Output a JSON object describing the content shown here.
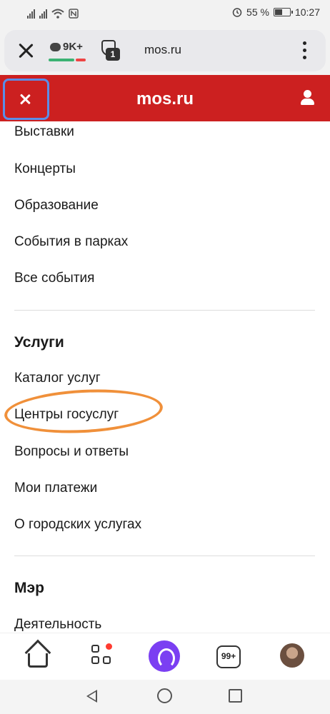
{
  "status_bar": {
    "battery_percent": "55 %",
    "battery_level": 0.55,
    "time": "10:27",
    "icons": [
      "signal-icon",
      "wifi-icon",
      "nfc-icon",
      "alarm-icon",
      "battery-icon"
    ]
  },
  "browser": {
    "comments_count": "9K+",
    "tabs_count": "1",
    "url": "mos.ru"
  },
  "site_header": {
    "title": "mos.ru",
    "accent": "#cc2020"
  },
  "menu": {
    "events_items": [
      "Выставки",
      "Концерты",
      "Образование",
      "События в парках",
      "Все события"
    ],
    "services_heading": "Услуги",
    "services_items": [
      "Каталог услуг",
      "Центры госуслуг",
      "Вопросы и ответы",
      "Мои платежи",
      "О городских услугах"
    ],
    "mayor_heading": "Мэр",
    "mayor_items": [
      "Деятельность"
    ],
    "highlight_color": "#f0903a"
  },
  "toolbar": {
    "tabs_badge": "99+",
    "alice_color": "#7b3ff2"
  }
}
